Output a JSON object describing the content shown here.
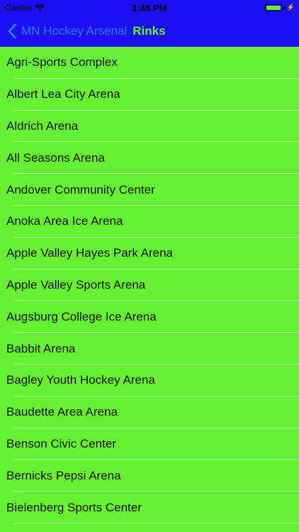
{
  "status_bar": {
    "carrier": "Carrier",
    "time": "1:45 PM",
    "battery_level": 1.0,
    "wifi_icon": "wifi-icon",
    "charging_icon": "bolt-icon"
  },
  "nav": {
    "back_label": "MN Hockey Arsenal",
    "back_icon": "chevron-left-icon",
    "title": "Rinks"
  },
  "colors": {
    "nav_background": "#1a10f2",
    "page_background": "#66f233",
    "back_link": "#2f7bff",
    "title": "#66f233"
  },
  "rinks": [
    "Agri-Sports Complex",
    "Albert Lea City Arena",
    "Aldrich Arena",
    "All Seasons Arena",
    "Andover Community Center",
    "Anoka Area Ice Arena",
    "Apple Valley Hayes Park Arena",
    "Apple Valley Sports Arena",
    "Augsburg College Ice Arena",
    "Babbit Arena",
    "Bagley Youth Hockey Arena",
    "Baudette Area Arena",
    "Benson Civic Center",
    "Bernicks Pepsi Arena",
    "Bielenberg Sports Center"
  ]
}
